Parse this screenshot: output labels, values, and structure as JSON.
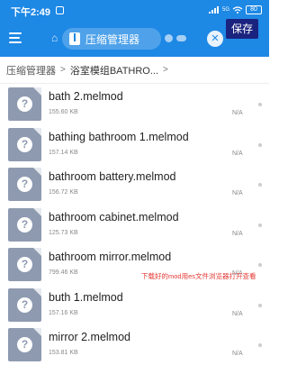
{
  "status_bar": {
    "time": "下午2:49",
    "network_tag": "5G",
    "battery": "80"
  },
  "toolbar": {
    "tab_label": "压缩管理器",
    "close_glyph": "✕",
    "save_label": "保存",
    "home_glyph": "⌂"
  },
  "breadcrumb": {
    "root": "压缩管理器",
    "separator": ">",
    "current": "浴室模组BATHRO...",
    "trailing": ">"
  },
  "files": [
    {
      "name": "bath 2.melmod",
      "size": "155.60 KB",
      "date": "N/A"
    },
    {
      "name": "bathing bathroom 1.melmod",
      "size": "157.14 KB",
      "date": "N/A"
    },
    {
      "name": "bathroom battery.melmod",
      "size": "156.72 KB",
      "date": "N/A"
    },
    {
      "name": "bathroom cabinet.melmod",
      "size": "125.73 KB",
      "date": "N/A"
    },
    {
      "name": "bathroom mirror.melmod",
      "size": "799.46 KB",
      "date": "N/A"
    },
    {
      "name": "buth 1.melmod",
      "size": "157.16 KB",
      "date": "N/A"
    },
    {
      "name": "mirror 2.melmod",
      "size": "153.81 KB",
      "date": "N/A"
    }
  ],
  "file_icon_glyph": "?",
  "overlay_note": "下载好的mod用es文件浏览器打开查看",
  "colors": {
    "header": "#1e88e5",
    "save_button": "#1a237e",
    "file_icon": "#8e9aaf",
    "note_text": "#e53935"
  }
}
